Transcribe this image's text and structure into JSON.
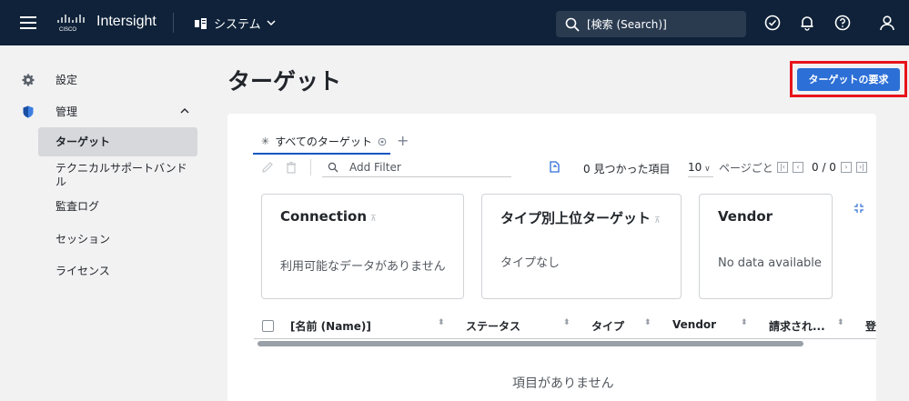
{
  "app": {
    "brand": "Intersight",
    "system_label": "システム",
    "search_placeholder": "[検索 (Search)]"
  },
  "sidebar": {
    "items": [
      {
        "label": "設定",
        "icon": "gear-icon"
      },
      {
        "label": "管理",
        "icon": "shield-icon"
      }
    ],
    "sub_items": [
      {
        "label": "ターゲット",
        "active": true
      },
      {
        "label": "テクニカルサポートバンドル"
      },
      {
        "label": "監査ログ"
      },
      {
        "label": "セッション"
      },
      {
        "label": "ライセンス"
      }
    ]
  },
  "main": {
    "title": "ターゲット",
    "request_button": "ターゲットの要求",
    "tab_label": "すべてのターゲット",
    "filter_placeholder": "Add Filter",
    "found_text": "0 見つかった項目",
    "per_page": "10",
    "per_page_label": "ページごと",
    "page_text": "0 / 0",
    "widgets": [
      {
        "title": "Connection",
        "body": "利用可能なデータがありません"
      },
      {
        "title": "タイプ別上位ターゲット",
        "body": "タイプなし"
      },
      {
        "title": "Vendor",
        "body": "No data available"
      }
    ],
    "columns": [
      "[名前 (Name)]",
      "ステータス",
      "タイプ",
      "Vendor",
      "請求され...",
      "登"
    ],
    "empty_text": "項目がありません"
  },
  "colors": {
    "topbar": "#0f2239",
    "primary": "#2c6fd6",
    "highlight": "#e8141b"
  }
}
